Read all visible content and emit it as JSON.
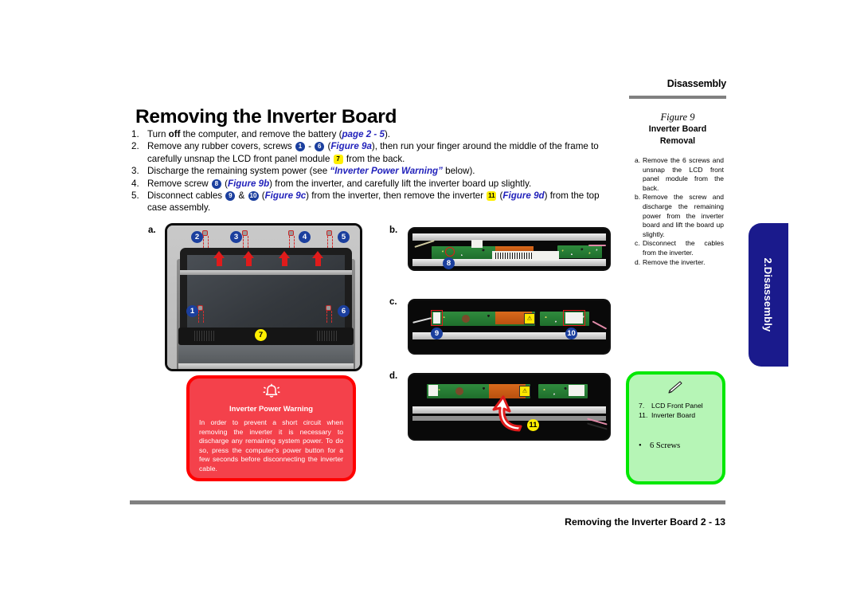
{
  "header": {
    "running_head": "Disassembly"
  },
  "title": "Removing the Inverter Board",
  "steps": [
    {
      "num": "1.",
      "parts": [
        {
          "t": "Turn ",
          "s": "n"
        },
        {
          "t": "off",
          "s": "b"
        },
        {
          "t": " the computer, and remove the battery (",
          "s": "n"
        },
        {
          "t": "page 2 - 5",
          "s": "blue-ital"
        },
        {
          "t": ").",
          "s": "n"
        }
      ]
    },
    {
      "num": "2.",
      "parts": [
        {
          "t": "Remove any rubber covers, screws ",
          "s": "n"
        },
        {
          "t": "1",
          "s": "badge"
        },
        {
          "t": " - ",
          "s": "n"
        },
        {
          "t": "6",
          "s": "badge"
        },
        {
          "t": " (",
          "s": "n"
        },
        {
          "t": "Figure 9a",
          "s": "blue-ital"
        },
        {
          "t": "), then run your finger around the middle of the frame to carefully unsnap the LCD front panel module ",
          "s": "n"
        },
        {
          "t": "7",
          "s": "badge-yellow"
        },
        {
          "t": " from the back.",
          "s": "n"
        }
      ]
    },
    {
      "num": "3.",
      "parts": [
        {
          "t": "Discharge the remaining system power (see ",
          "s": "n"
        },
        {
          "t": "“Inverter Power Warning”",
          "s": "blue-ital"
        },
        {
          "t": "  below).",
          "s": "n"
        }
      ]
    },
    {
      "num": "4.",
      "parts": [
        {
          "t": "Remove screw ",
          "s": "n"
        },
        {
          "t": "8",
          "s": "badge"
        },
        {
          "t": " (",
          "s": "n"
        },
        {
          "t": "Figure 9b",
          "s": "blue-ital"
        },
        {
          "t": ") from the inverter, and carefully lift the inverter board up slightly.",
          "s": "n"
        }
      ]
    },
    {
      "num": "5.",
      "parts": [
        {
          "t": "Disconnect cables ",
          "s": "n"
        },
        {
          "t": "9",
          "s": "badge"
        },
        {
          "t": " & ",
          "s": "n"
        },
        {
          "t": "10",
          "s": "badge-wide"
        },
        {
          "t": " (",
          "s": "n"
        },
        {
          "t": "Figure 9c",
          "s": "blue-ital"
        },
        {
          "t": ") from the inverter, then remove the inverter ",
          "s": "n"
        },
        {
          "t": "11",
          "s": "badge-yellow"
        },
        {
          "t": " (",
          "s": "n"
        },
        {
          "t": "Figure 9d",
          "s": "blue-ital"
        },
        {
          "t": ") from the top case assembly.",
          "s": "n"
        }
      ]
    }
  ],
  "panels": {
    "a_letter": "a.",
    "b_letter": "b.",
    "c_letter": "c.",
    "d_letter": "d.",
    "a_callouts": [
      "1",
      "2",
      "3",
      "4",
      "5",
      "6",
      "7"
    ],
    "b_callouts": [
      "8"
    ],
    "c_callouts": [
      "9",
      "10"
    ],
    "d_callouts": [
      "11"
    ]
  },
  "warning": {
    "icon": "ringing-bell-icon",
    "title": "Inverter Power Warning",
    "body": "In order to prevent a short circuit when removing the inverter it is necessary to discharge any remaining system power.  To do so, press the computer’s power button for a few seconds before disconnecting the inverter cable.",
    "border_color": "#FF0000",
    "fill_color": "#F4414B"
  },
  "green_note": {
    "icon": "pen-icon",
    "items": [
      {
        "n": "7.",
        "label": "LCD Front Panel"
      },
      {
        "n": "11.",
        "label": "Inverter Board"
      }
    ],
    "bullet": "6 Screws",
    "bullet_mark": "•",
    "border_color": "#00E800",
    "fill_color": "#B6F5B6"
  },
  "sidebar": {
    "figure_label": "Figure 9",
    "figure_caption_line1": "Inverter Board",
    "figure_caption_line2": "Removal",
    "items": [
      {
        "letter": "a.",
        "text": "Remove the 6 screws and unsnap the LCD front panel module from the back."
      },
      {
        "letter": "b.",
        "text": "Remove the screw and discharge the remaining power from the inverter board and lift the board up slightly."
      },
      {
        "letter": "c.",
        "text": "Disconnect the cables from the inverter."
      },
      {
        "letter": "d.",
        "text": "Remove the inverter."
      }
    ]
  },
  "side_tab": {
    "label": "2.Disassembly",
    "color": "#1A1A8C"
  },
  "footer": {
    "text": "Removing the Inverter Board  2  -  13"
  }
}
